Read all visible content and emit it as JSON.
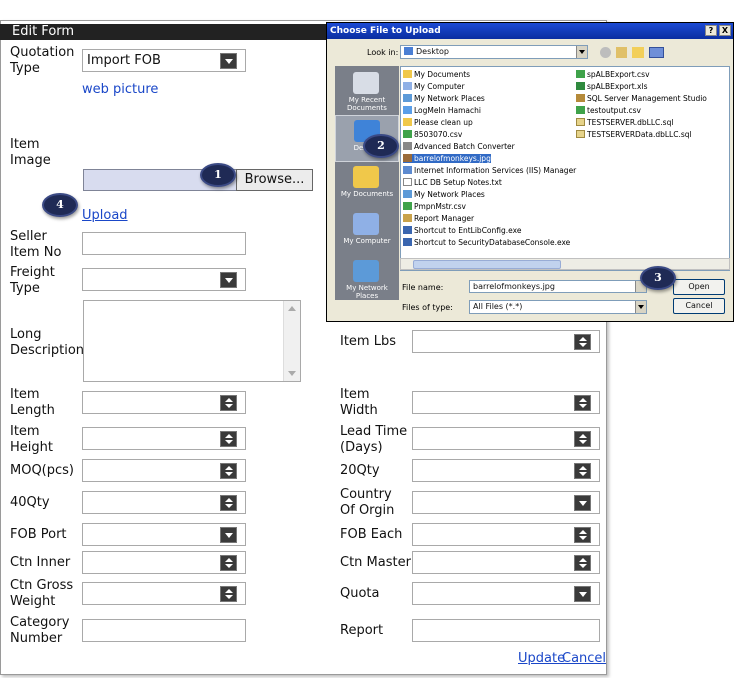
{
  "form": {
    "title": "Edit Form",
    "quotation_type_label": "Quotation Type",
    "quotation_type_value": "Import FOB",
    "web_picture_link": "web picture",
    "item_image_label": "Item Image",
    "browse_label": "Browse...",
    "upload_link": "Upload",
    "seller_item_no_label": "Seller Item No",
    "freight_type_label": "Freight Type",
    "long_description_label": "Long Description",
    "item_lbs_label": "Item Lbs",
    "item_length_label": "Item Length",
    "item_width_label": "Item Width",
    "item_height_label": "Item Height",
    "lead_time_label": "Lead Time (Days)",
    "moq_label": "MOQ(pcs)",
    "qty20_label": "20Qty",
    "qty40_label": "40Qty",
    "country_label": "Country Of Orgin",
    "fob_port_label": "FOB Port",
    "fob_each_label": "FOB Each",
    "ctn_inner_label": "Ctn Inner",
    "ctn_master_label": "Ctn Master",
    "ctn_gross_weight_label": "Ctn Gross Weight",
    "quota_label": "Quota",
    "category_number_label": "Category Number",
    "report_label": "Report",
    "update_link": "Update",
    "cancel_link": "Cancel"
  },
  "badges": [
    "1",
    "2",
    "3",
    "4"
  ],
  "dialog": {
    "title": "Choose File to Upload",
    "help_btn": "?",
    "close_btn": "X",
    "look_in_label": "Look in:",
    "look_in_value": "Desktop",
    "places": [
      "My Recent Documents",
      "Desktop",
      "My Documents",
      "My Computer",
      "My Network Places"
    ],
    "files_col1": [
      "My Documents",
      "My Computer",
      "My Network Places",
      "LogMeIn Hamachi",
      "Please clean up",
      "8503070.csv",
      "Advanced Batch Converter",
      "barrelofmonkeys.jpg",
      "Internet Information Services (IIS) Manager",
      "LLC DB Setup Notes.txt",
      "My Network Places",
      "PmpnMstr.csv",
      "Report Manager",
      "Shortcut to EntLibConfig.exe",
      "Shortcut to SecurityDatabaseConsole.exe"
    ],
    "files_col2": [
      "spALBExport.csv",
      "spALBExport.xls",
      "SQL Server Management Studio",
      "testoutput.csv",
      "TESTSERVER.dbLLC.sql",
      "TESTSERVERData.dbLLC.sql"
    ],
    "file_name_label": "File name:",
    "file_name_value": "barrelofmonkeys.jpg",
    "files_of_type_label": "Files of type:",
    "files_of_type_value": "All Files (*.*)",
    "open_btn": "Open",
    "cancel_btn": "Cancel"
  },
  "colors": {
    "header_bg": "#222222",
    "link": "#1a47c8",
    "badge": "#1f2a55",
    "dialog_title": "#0a2ea0",
    "dialog_bg": "#ece9d8"
  }
}
